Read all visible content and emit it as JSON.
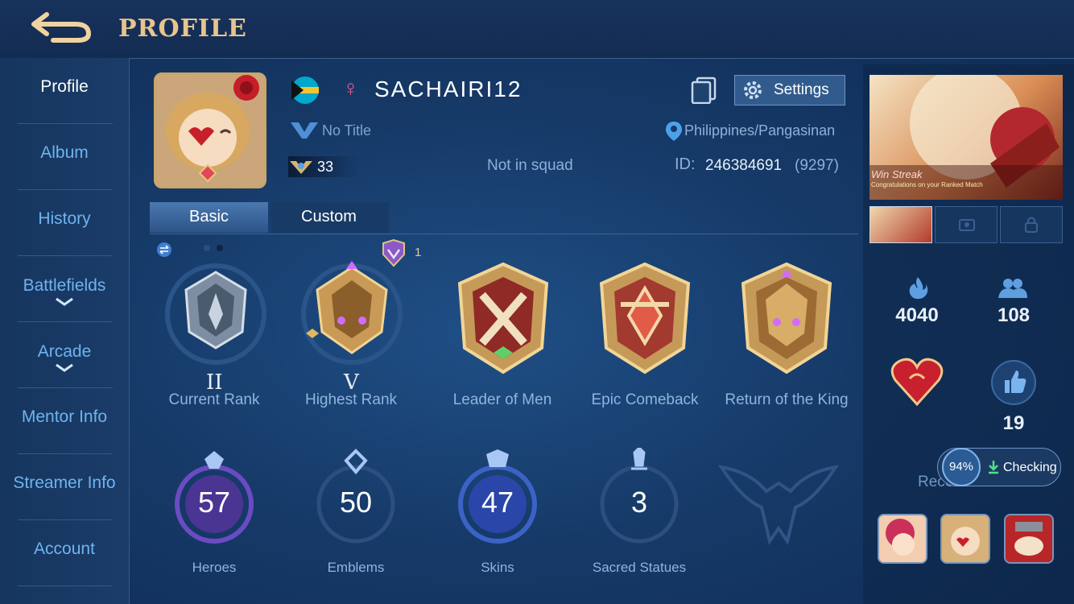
{
  "header": {
    "title": "PROFILE",
    "back_icon": "back-arrow-icon"
  },
  "sidebar": {
    "items": [
      {
        "label": "Profile",
        "active": true
      },
      {
        "label": "Album"
      },
      {
        "label": "History"
      },
      {
        "label": "Battlefields",
        "expandable": true
      },
      {
        "label": "Arcade",
        "expandable": true
      },
      {
        "label": "Mentor Info"
      },
      {
        "label": "Streamer Info"
      },
      {
        "label": "Account"
      }
    ]
  },
  "profile": {
    "username": "SACHAIRI12",
    "gender_symbol": "♀",
    "title": "No Title",
    "level": "33",
    "squad": "Not in squad",
    "location": "Philippines/Pangasinan",
    "id_label": "ID:",
    "id_value": "246384691",
    "id_extra": "(9297)",
    "settings_label": "Settings"
  },
  "tabs": [
    {
      "label": "Basic",
      "active": true
    },
    {
      "label": "Custom"
    }
  ],
  "ranks": {
    "badge_count": "1",
    "items": [
      {
        "label": "Current Rank",
        "tier": "II"
      },
      {
        "label": "Highest Rank",
        "tier": "V"
      },
      {
        "label": "Leader of Men"
      },
      {
        "label": "Epic Comeback"
      },
      {
        "label": "Return of the King"
      }
    ]
  },
  "stats": [
    {
      "value": "57",
      "label": "Heroes"
    },
    {
      "value": "50",
      "label": "Emblems"
    },
    {
      "value": "47",
      "label": "Skins"
    },
    {
      "value": "3",
      "label": "Sacred Statues"
    }
  ],
  "right": {
    "banner_title": "Win Streak",
    "banner_subtitle": "Congratulations on your Ranked Match",
    "popularity": "4040",
    "followers": "108",
    "likes": "19",
    "progress_pct": "94%",
    "checking_label": "Checking",
    "recent_visits_label": "Recent Visits"
  },
  "colors": {
    "accent_gold": "#e7c58d",
    "nav_blue": "#6fb3f0",
    "bg": "#163a68"
  }
}
